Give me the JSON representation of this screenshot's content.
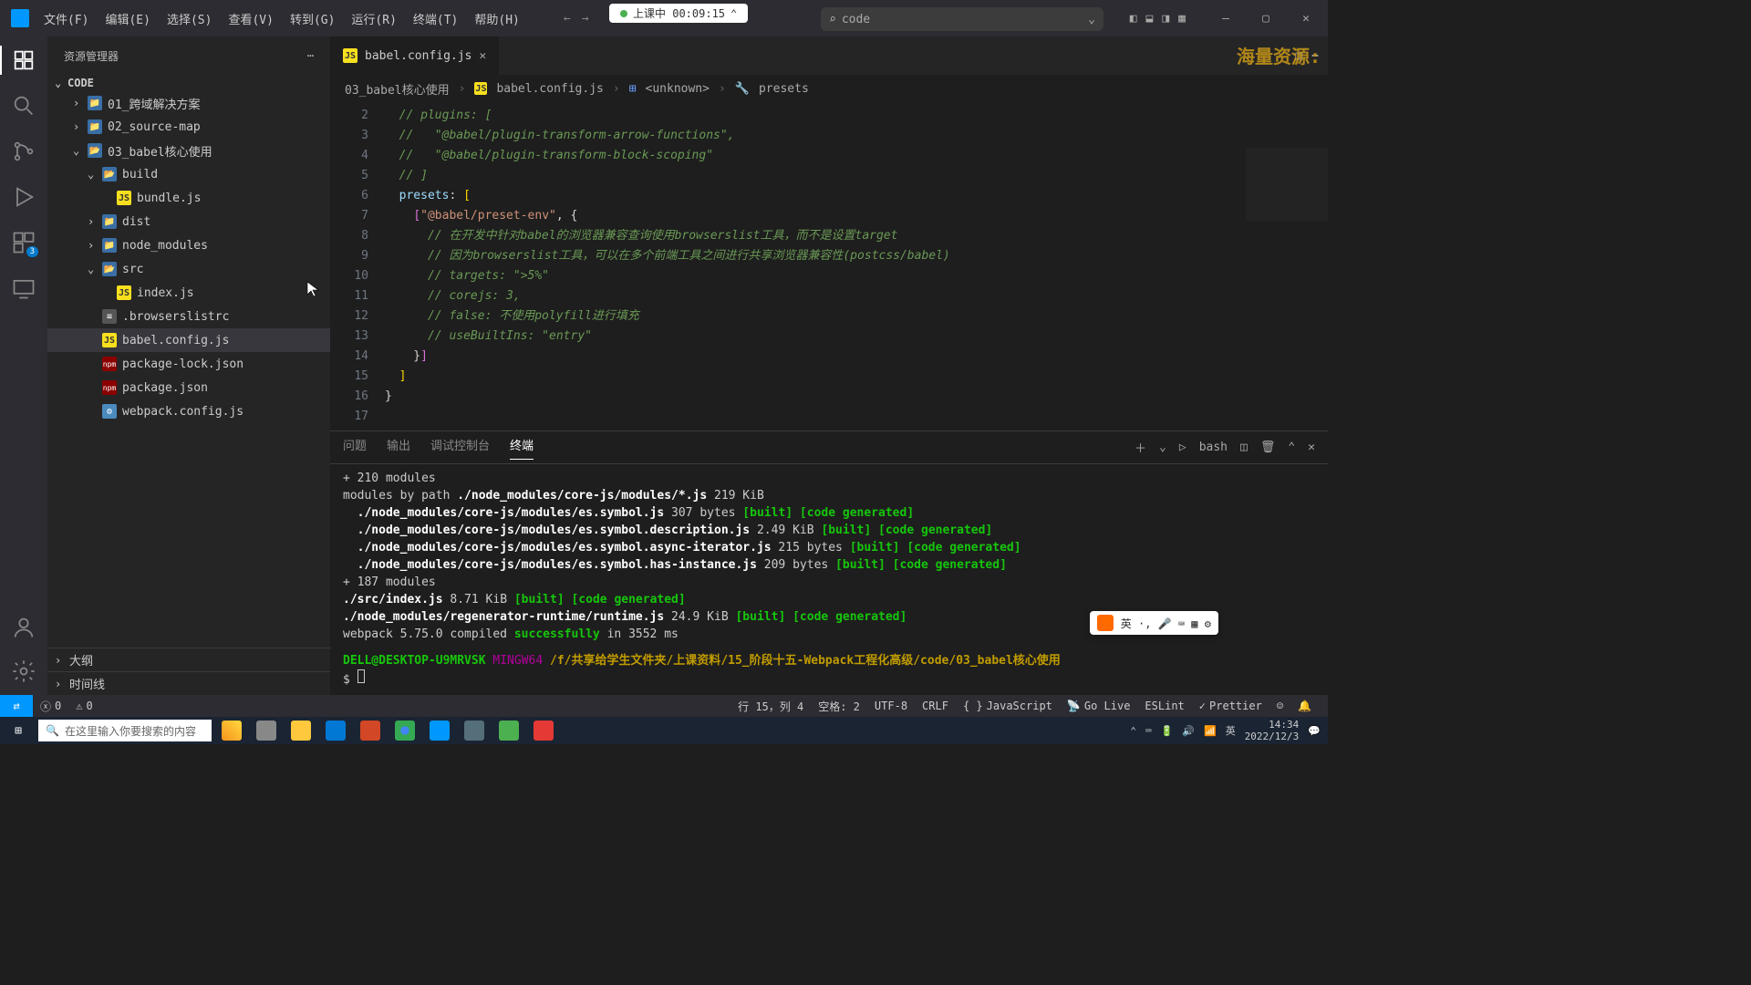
{
  "menus": [
    "文件(F)",
    "编辑(E)",
    "选择(S)",
    "查看(V)",
    "转到(G)",
    "运行(R)",
    "终端(T)",
    "帮助(H)"
  ],
  "recording": {
    "label": "上课中 00:09:15"
  },
  "search": {
    "text": "code"
  },
  "sidebar": {
    "title": "资源管理器",
    "root": "CODE",
    "items": [
      {
        "label": "01_跨域解决方案",
        "l": 1,
        "chev": "›",
        "icon": "folder"
      },
      {
        "label": "02_source-map",
        "l": 1,
        "chev": "›",
        "icon": "folder"
      },
      {
        "label": "03_babel核心使用",
        "l": 1,
        "chev": "⌄",
        "icon": "folder-open"
      },
      {
        "label": "build",
        "l": 2,
        "chev": "⌄",
        "icon": "folder-open"
      },
      {
        "label": "bundle.js",
        "l": 3,
        "chev": "",
        "icon": "js"
      },
      {
        "label": "dist",
        "l": 2,
        "chev": "›",
        "icon": "folder"
      },
      {
        "label": "node_modules",
        "l": 2,
        "chev": "›",
        "icon": "folder"
      },
      {
        "label": "src",
        "l": 2,
        "chev": "⌄",
        "icon": "folder-open"
      },
      {
        "label": "index.js",
        "l": 3,
        "chev": "",
        "icon": "js"
      },
      {
        "label": ".browserslistrc",
        "l": 2,
        "chev": "",
        "icon": "txt"
      },
      {
        "label": "babel.config.js",
        "l": 2,
        "chev": "",
        "icon": "js",
        "active": true
      },
      {
        "label": "package-lock.json",
        "l": 2,
        "chev": "",
        "icon": "json"
      },
      {
        "label": "package.json",
        "l": 2,
        "chev": "",
        "icon": "json"
      },
      {
        "label": "webpack.config.js",
        "l": 2,
        "chev": "",
        "icon": "cfg"
      }
    ],
    "outline": "大纲",
    "timeline": "时间线"
  },
  "tab": {
    "filename": "babel.config.js"
  },
  "breadcrumb": [
    "03_babel核心使用",
    "babel.config.js",
    "<unknown>",
    "presets"
  ],
  "code": {
    "start": 2,
    "lines": [
      {
        "t": "  // plugins: [",
        "cls": "c-comment"
      },
      {
        "t": "  //   \"@babel/plugin-transform-arrow-functions\",",
        "cls": "c-comment"
      },
      {
        "t": "  //   \"@babel/plugin-transform-block-scoping\"",
        "cls": "c-comment"
      },
      {
        "t": "  // ]",
        "cls": "c-comment"
      },
      {
        "pre": "  ",
        "key": "presets",
        "post": ": ",
        "br": "["
      },
      {
        "pre": "    ",
        "br2": "[",
        "str": "\"@babel/preset-env\"",
        "post": ", {"
      },
      {
        "t": "      // 在开发中针对babel的浏览器兼容查询使用browserslist工具，而不是设置target",
        "cls": "c-comment"
      },
      {
        "t": "      // 因为browserslist工具，可以在多个前端工具之间进行共享浏览器兼容性(postcss/babel)",
        "cls": "c-comment"
      },
      {
        "t": "      // targets: \">5%\"",
        "cls": "c-comment"
      },
      {
        "t": "      // corejs: 3,",
        "cls": "c-comment"
      },
      {
        "t": "      // false: 不使用polyfill进行填充",
        "cls": "c-comment"
      },
      {
        "t": "      // useBuiltIns: \"entry\"",
        "cls": "c-comment"
      },
      {
        "pre": "    }",
        "br2": "]"
      },
      {
        "pre": "  ",
        "br": "]"
      },
      {
        "t": "}",
        "cls": "c-punct"
      },
      {
        "t": "",
        "cls": ""
      }
    ]
  },
  "panel": {
    "tabs": [
      "问题",
      "输出",
      "调试控制台",
      "终端"
    ],
    "activeTab": 3,
    "shell": "bash"
  },
  "terminal": {
    "modcount": "  + 210 modules",
    "l1a": "modules by path ",
    "l1b": "./node_modules/core-js/modules/*.js",
    "l1c": " 219 KiB",
    "rows": [
      {
        "path": "./node_modules/core-js/modules/es.symbol.js",
        "size": " 307 bytes "
      },
      {
        "path": "./node_modules/core-js/modules/es.symbol.description.js",
        "size": " 2.49 KiB "
      },
      {
        "path": "./node_modules/core-js/modules/es.symbol.async-iterator.js",
        "size": " 215 bytes "
      },
      {
        "path": "./node_modules/core-js/modules/es.symbol.has-instance.js",
        "size": " 209 bytes "
      }
    ],
    "built": "[built]",
    "codegen": " [code generated]",
    "mod187": "  + 187 modules",
    "idx_path": "./src/index.js",
    "idx_size": " 8.71 KiB ",
    "rt_path": "./node_modules/regenerator-runtime/runtime.js",
    "rt_size": " 24.9 KiB ",
    "wp_a": "webpack 5.75.0 compiled ",
    "wp_ok": "successfully",
    "wp_b": " in 3552 ms",
    "ps_user": "DELL@DESKTOP-U9MRVSK ",
    "ps_mingw": "MINGW64 ",
    "ps_path": "/f/共享给学生文件夹/上课资料",
    "ps_seg": "/15_阶段十五-Webpack工程化高级",
    "ps_tail": "/code/03_babel核心使用",
    "prompt": "$ "
  },
  "status": {
    "errors": "0",
    "warnings": "0",
    "pos": "行 15，列 4",
    "spaces": "空格: 2",
    "enc": "UTF-8",
    "eol": "CRLF",
    "lang": "JavaScript",
    "golive": "Go Live",
    "eslint": "ESLint",
    "prettier": "Prettier"
  },
  "watermark": "海量资源:",
  "taskbar": {
    "search_ph": "在这里输入你要搜索的内容",
    "time": "14:34",
    "date": "2022/12/3"
  }
}
